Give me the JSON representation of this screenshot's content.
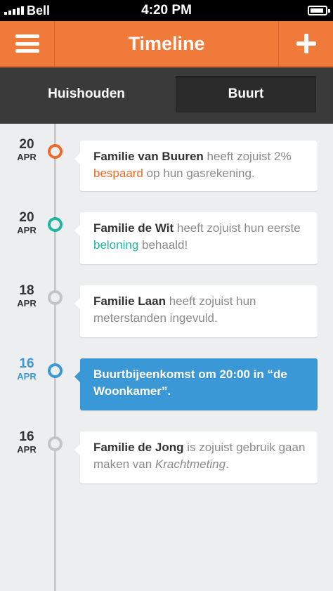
{
  "status_bar": {
    "carrier": "Bell",
    "time": "4:20 PM",
    "battery_level": 0.7,
    "signal_bars": 5
  },
  "header": {
    "title": "Timeline",
    "menu_icon": "hamburger-icon",
    "add_icon": "plus-icon"
  },
  "tabs": [
    {
      "label": "Huishouden",
      "selected": false
    },
    {
      "label": "Buurt",
      "selected": true
    }
  ],
  "colors": {
    "header": "#f07a3a",
    "orange": "#ec6a2c",
    "teal": "#1fb6a2",
    "blue": "#3b98d6",
    "gray": "#c2c4c6"
  },
  "timeline": [
    {
      "day": "20",
      "month": "APR",
      "dot_color": "#ec6a2c",
      "date_color": "#333333",
      "name": "Familie van Buuren",
      "text_before": " heeft zojuist 2% ",
      "highlight": "bespaard",
      "text_after": " op hun gasrekening."
    },
    {
      "day": "20",
      "month": "APR",
      "dot_color": "#1fb6a2",
      "date_color": "#333333",
      "name": "Familie de Wit",
      "text_before": " heeft zojuist hun eerste ",
      "highlight": "beloning",
      "text_after": " behaald!"
    },
    {
      "day": "18",
      "month": "APR",
      "dot_color": "#c2c4c6",
      "date_color": "#333333",
      "name": "Familie Laan",
      "text_before": " heeft zojuist hun meterstanden ingevuld."
    },
    {
      "day": "16",
      "month": "APR",
      "dot_color": "#3b98d6",
      "date_color": "#3b98d6",
      "text": "Buurtbijeenkomst om 20:00 in “de Woonkamer”."
    },
    {
      "day": "16",
      "month": "APR",
      "dot_color": "#c2c4c6",
      "date_color": "#333333",
      "name": "Familie de Jong",
      "text_before": " is zojuist gebruik gaan maken van ",
      "emphasis": "Krachtmeting",
      "text_after": "."
    }
  ]
}
